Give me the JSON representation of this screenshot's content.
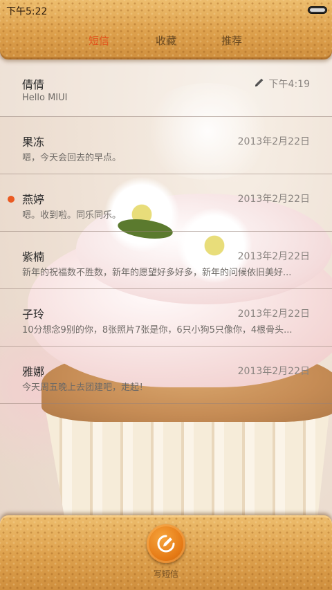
{
  "status_bar": {
    "time": "下午5:22"
  },
  "tabs": [
    {
      "label": "短信",
      "active": true
    },
    {
      "label": "收藏",
      "active": false
    },
    {
      "label": "推荐",
      "active": false
    }
  ],
  "messages": [
    {
      "name": "倩倩",
      "preview": "Hello MIUI",
      "date": "下午4:19",
      "draft": true,
      "unread": false
    },
    {
      "name": "果冻",
      "preview": "嗯，今天会回去的早点。",
      "date": "2013年2月22日",
      "draft": false,
      "unread": false
    },
    {
      "name": "燕婷",
      "preview": "嗯。收到啦。同乐同乐。",
      "date": "2013年2月22日",
      "draft": false,
      "unread": true
    },
    {
      "name": "紫楠",
      "preview": "新年的祝福数不胜数，新年的愿望好多好多，新年的问候依旧美好...",
      "date": "2013年2月22日",
      "draft": false,
      "unread": false
    },
    {
      "name": "子玲",
      "preview": "10分想念9别的你，8张照片7张是你，6只小狗5只像你，4根骨头...",
      "date": "2013年2月22日",
      "draft": false,
      "unread": false
    },
    {
      "name": "雅娜",
      "preview": "今天周五晚上去团建吧，走起！",
      "date": "2013年2月22日",
      "draft": false,
      "unread": false
    }
  ],
  "bottom_bar": {
    "compose_label": "写短信"
  },
  "colors": {
    "accent": "#e2541c",
    "unread_dot": "#ea5a22",
    "cracker": "#e0a650"
  },
  "icons": {
    "draft": "pencil-icon",
    "compose": "compose-icon",
    "battery": "battery-icon"
  }
}
